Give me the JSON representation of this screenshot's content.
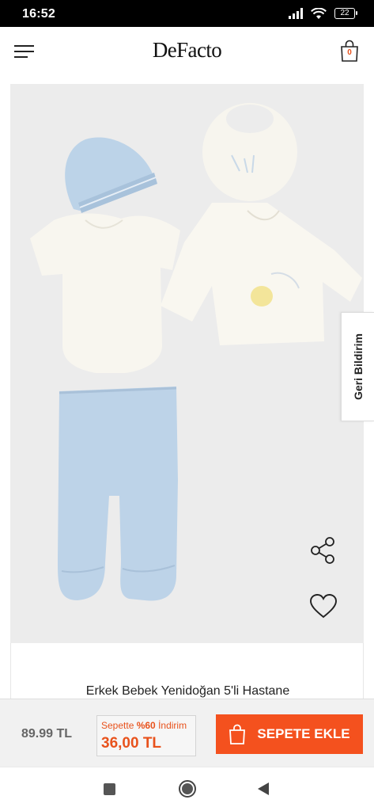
{
  "status_bar": {
    "time": "16:52",
    "battery": "22",
    "icons": [
      "signal-icon",
      "wifi-icon",
      "battery-icon"
    ]
  },
  "header": {
    "brand": "DeFacto",
    "cart_count": "0",
    "icons": [
      "hamburger-menu-icon",
      "shopping-bag-icon"
    ]
  },
  "product": {
    "title": "Erkek Bebek Yenidoğan 5'li Hastane",
    "image_description_icons": [
      "share-icon",
      "heart-icon"
    ]
  },
  "feedback": {
    "label": "Geri Bildirim"
  },
  "price_bar": {
    "old_price": "89.99 TL",
    "discount_prefix": "Sepette ",
    "discount_percent": "%60",
    "discount_suffix": " İndirim",
    "new_price": "36,00 TL",
    "add_to_cart": "SEPETE EKLE"
  },
  "colors": {
    "accent": "#f4511e",
    "discount_text": "#e8521c",
    "image_bg": "#ececec",
    "baby_blue": "#b7cfe4",
    "cream": "#f8f6ef"
  },
  "nav_bar": {
    "icons": [
      "recents-square-icon",
      "home-circle-icon",
      "back-triangle-icon"
    ]
  }
}
